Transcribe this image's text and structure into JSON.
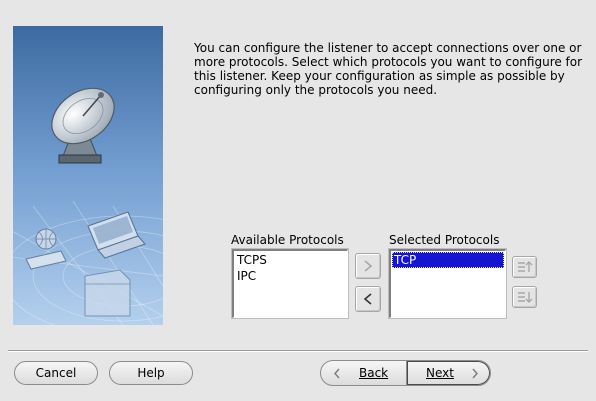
{
  "intro_text": "You can configure the listener to accept connections over one or more protocols. Select which protocols you want to configure for this listener. Keep your configuration as simple as possible by configuring only the protocols you need.",
  "available": {
    "label": "Available Protocols",
    "items": [
      "TCPS",
      "IPC"
    ]
  },
  "selected": {
    "label": "Selected Protocols",
    "items": [
      "TCP"
    ]
  },
  "buttons": {
    "cancel": "Cancel",
    "help": "Help",
    "back": "Back",
    "next": "Next"
  },
  "colors": {
    "window_bg": "#e6e6e6",
    "selection": "#1414d2",
    "panel_top": "#3f6ea3",
    "panel_bottom": "#a9c8ea"
  },
  "icons": {
    "add": "chevron-right-icon",
    "remove": "chevron-left-icon",
    "move_up": "move-up-icon",
    "move_down": "move-down-icon",
    "panel": "satellite-dish-icon"
  }
}
